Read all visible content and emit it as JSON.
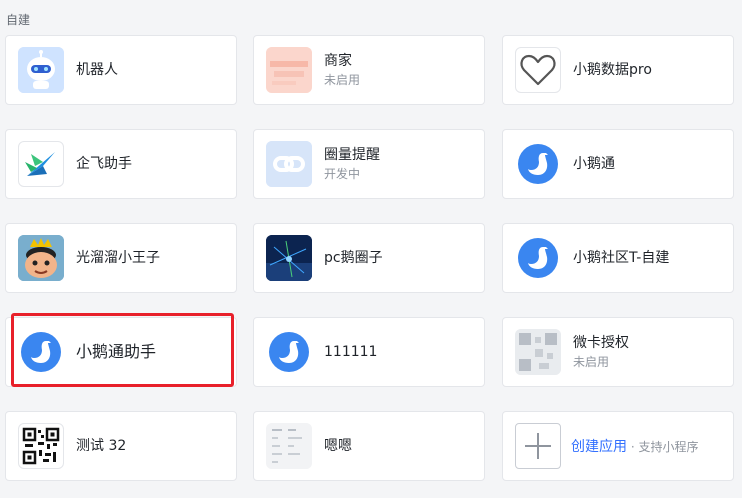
{
  "section": {
    "label": "自建"
  },
  "apps": [
    {
      "name": "机器人",
      "sub": "",
      "icon": "robot-icon"
    },
    {
      "name": "商家",
      "sub": "未启用",
      "icon": "merchant-icon"
    },
    {
      "name": "小鹅数据pro",
      "sub": "",
      "icon": "heart-icon"
    },
    {
      "name": "企飞助手",
      "sub": "",
      "icon": "plane-arrow-icon"
    },
    {
      "name": "圈量提醒",
      "sub": "开发中",
      "icon": "link-chain-icon"
    },
    {
      "name": "小鹅通",
      "sub": "",
      "icon": "goose-icon"
    },
    {
      "name": "光溜溜小王子",
      "sub": "",
      "icon": "prince-avatar-icon"
    },
    {
      "name": "pc鹅圈子",
      "sub": "",
      "icon": "network-image-icon"
    },
    {
      "name": "小鹅社区T-自建",
      "sub": "",
      "icon": "goose-icon"
    },
    {
      "name": "小鹅通助手",
      "sub": "",
      "icon": "goose-icon"
    },
    {
      "name": "111111",
      "sub": "",
      "icon": "goose-icon"
    },
    {
      "name": "微卡授权",
      "sub": "未启用",
      "icon": "qr-blurred-icon"
    },
    {
      "name": "测试 32",
      "sub": "",
      "icon": "qr-code-icon"
    },
    {
      "name": "嗯嗯",
      "sub": "",
      "icon": "document-thumb-icon"
    }
  ],
  "create": {
    "link": "创建应用",
    "hint": " · 支持小程序",
    "icon": "plus-icon"
  },
  "colors": {
    "accent": "#3370ff",
    "goose_blue": "#3a86f0",
    "highlight": "#e8202a"
  }
}
